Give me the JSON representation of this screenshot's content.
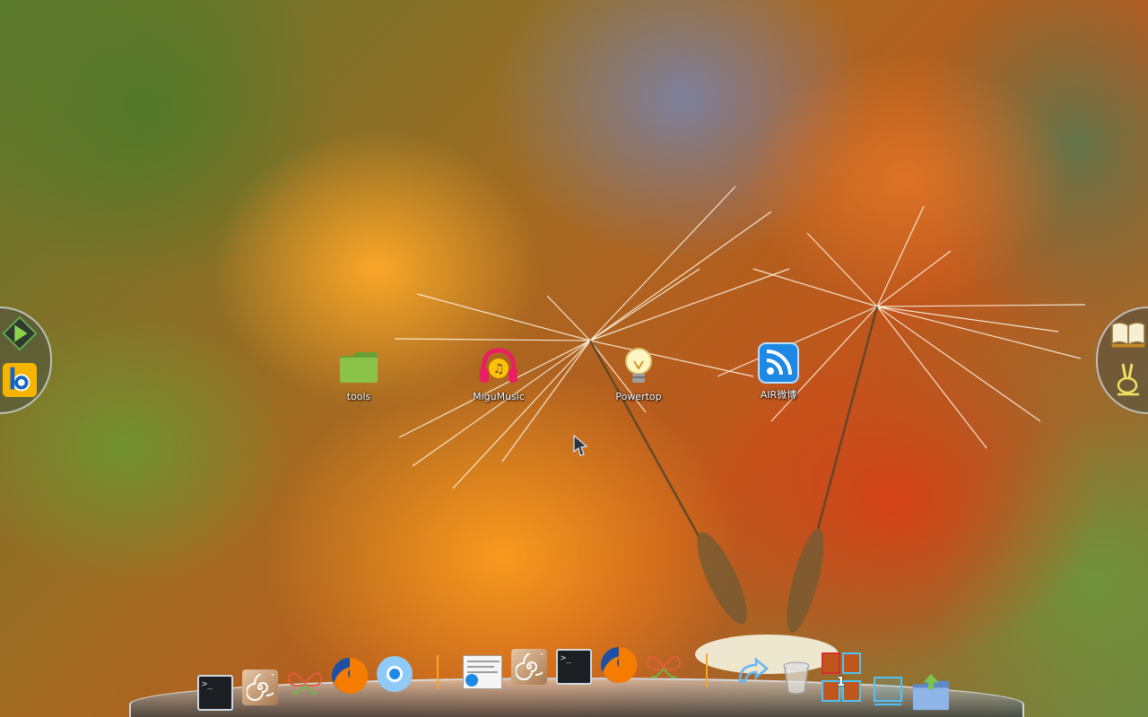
{
  "desktop": {
    "icons": [
      {
        "label": "tools",
        "icon": "folder-icon"
      },
      {
        "label": "MiguMusic",
        "icon": "music-icon"
      },
      {
        "label": "Powertop",
        "icon": "lightbulb-icon"
      },
      {
        "label": "AIR微博",
        "icon": "rss-icon"
      }
    ]
  },
  "left_panel": {
    "items": [
      {
        "icon": "run-arrow-icon"
      },
      {
        "icon": "b-app-icon"
      }
    ]
  },
  "right_panel": {
    "items": [
      {
        "icon": "open-book-icon"
      },
      {
        "icon": "rabbit-icon"
      }
    ]
  },
  "dock": {
    "items": [
      {
        "icon": "terminal-icon",
        "glyph": ">_"
      },
      {
        "icon": "nautilus-shell-icon"
      },
      {
        "icon": "butterfly-icon"
      },
      {
        "icon": "firefox-icon"
      },
      {
        "icon": "chromium-icon"
      },
      {
        "icon": "separator-icon"
      },
      {
        "icon": "screenshot-document-icon"
      },
      {
        "icon": "nautilus-shell-icon"
      },
      {
        "icon": "terminal-icon",
        "glyph": ">_"
      },
      {
        "icon": "firefox-icon"
      },
      {
        "icon": "butterfly-icon"
      },
      {
        "icon": "separator-icon"
      },
      {
        "icon": "recycle-arrow-icon"
      },
      {
        "icon": "trash-icon"
      },
      {
        "icon": "workspace-switcher-icon",
        "badge": "1"
      },
      {
        "icon": "desktop-frame-icon"
      },
      {
        "icon": "home-folder-upload-icon"
      }
    ]
  },
  "colors": {
    "folder_green": "#7cb342",
    "rss_blue": "#1e88e5",
    "music_pink": "#e91e63",
    "panel_border": "#d2d7d7"
  }
}
